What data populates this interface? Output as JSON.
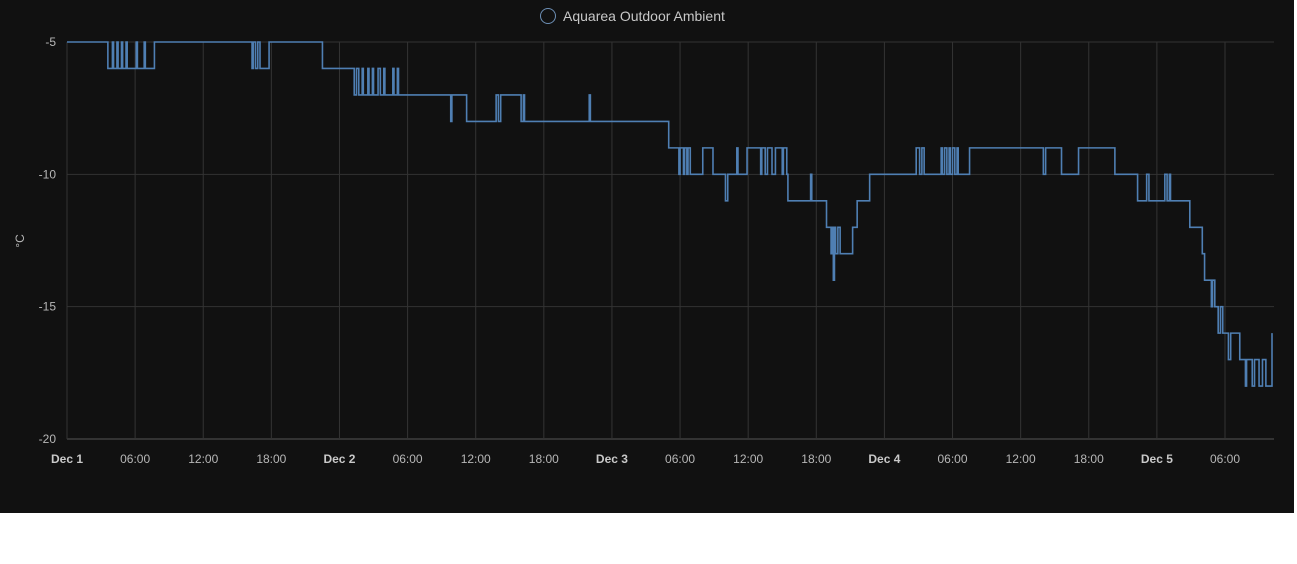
{
  "legend": {
    "label": "Aquarea Outdoor Ambient",
    "color": "#6d8fb5"
  },
  "colors": {
    "background": "#111111",
    "grid": "#333333",
    "line": "#4f7fb3",
    "text": "#b7b7b7"
  },
  "chart_data": {
    "type": "line",
    "ylabel": "°C",
    "ylim": [
      -20,
      -5
    ],
    "yticks": [
      -5,
      -10,
      -15,
      -20
    ],
    "xlim_hours": [
      0,
      104.5
    ],
    "xticks": [
      {
        "h": 0,
        "label": "Dec 1",
        "major": true
      },
      {
        "h": 6,
        "label": "06:00",
        "major": false
      },
      {
        "h": 12,
        "label": "12:00",
        "major": false
      },
      {
        "h": 18,
        "label": "18:00",
        "major": false
      },
      {
        "h": 24,
        "label": "Dec 2",
        "major": true
      },
      {
        "h": 30,
        "label": "06:00",
        "major": false
      },
      {
        "h": 36,
        "label": "12:00",
        "major": false
      },
      {
        "h": 42,
        "label": "18:00",
        "major": false
      },
      {
        "h": 48,
        "label": "Dec 3",
        "major": true
      },
      {
        "h": 54,
        "label": "06:00",
        "major": false
      },
      {
        "h": 60,
        "label": "12:00",
        "major": false
      },
      {
        "h": 66,
        "label": "18:00",
        "major": false
      },
      {
        "h": 72,
        "label": "Dec 4",
        "major": true
      },
      {
        "h": 78,
        "label": "06:00",
        "major": false
      },
      {
        "h": 84,
        "label": "12:00",
        "major": false
      },
      {
        "h": 90,
        "label": "18:00",
        "major": false
      },
      {
        "h": 96,
        "label": "Dec 5",
        "major": true
      },
      {
        "h": 102,
        "label": "06:00",
        "major": false
      }
    ],
    "grid": true,
    "legend_position": "top-center",
    "series": [
      {
        "name": "Aquarea Outdoor Ambient",
        "points": [
          [
            0,
            -5
          ],
          [
            3.6,
            -6
          ],
          [
            4.0,
            -5
          ],
          [
            4.1,
            -6
          ],
          [
            4.4,
            -5
          ],
          [
            4.5,
            -6
          ],
          [
            4.8,
            -5
          ],
          [
            4.9,
            -6
          ],
          [
            5.2,
            -5
          ],
          [
            5.3,
            -6
          ],
          [
            6.1,
            -5
          ],
          [
            6.2,
            -6
          ],
          [
            6.8,
            -5
          ],
          [
            6.9,
            -6
          ],
          [
            7.7,
            -5
          ],
          [
            16.3,
            -6
          ],
          [
            16.4,
            -5
          ],
          [
            16.6,
            -6
          ],
          [
            16.8,
            -5
          ],
          [
            17.0,
            -6
          ],
          [
            17.8,
            -5
          ],
          [
            22.5,
            -6
          ],
          [
            25.3,
            -7
          ],
          [
            25.5,
            -6
          ],
          [
            25.7,
            -7
          ],
          [
            26.0,
            -6
          ],
          [
            26.1,
            -7
          ],
          [
            26.5,
            -6
          ],
          [
            26.6,
            -7
          ],
          [
            26.9,
            -6
          ],
          [
            27.0,
            -7
          ],
          [
            27.4,
            -6
          ],
          [
            27.6,
            -7
          ],
          [
            27.9,
            -6
          ],
          [
            28.0,
            -7
          ],
          [
            28.7,
            -6
          ],
          [
            28.8,
            -7
          ],
          [
            29.1,
            -6
          ],
          [
            29.2,
            -7
          ],
          [
            33.8,
            -8
          ],
          [
            33.9,
            -7
          ],
          [
            35.2,
            -8
          ],
          [
            37.8,
            -7
          ],
          [
            38.0,
            -8
          ],
          [
            38.2,
            -7
          ],
          [
            40.0,
            -8
          ],
          [
            40.2,
            -7
          ],
          [
            40.3,
            -8
          ],
          [
            46.0,
            -7
          ],
          [
            46.1,
            -8
          ],
          [
            53.0,
            -9
          ],
          [
            53.9,
            -10
          ],
          [
            54.0,
            -9
          ],
          [
            54.3,
            -10
          ],
          [
            54.4,
            -9
          ],
          [
            54.6,
            -10
          ],
          [
            54.7,
            -9
          ],
          [
            54.9,
            -10
          ],
          [
            56.0,
            -9
          ],
          [
            56.9,
            -10
          ],
          [
            58.0,
            -11
          ],
          [
            58.2,
            -10
          ],
          [
            59.0,
            -9
          ],
          [
            59.1,
            -10
          ],
          [
            59.9,
            -9
          ],
          [
            61.1,
            -10
          ],
          [
            61.2,
            -9
          ],
          [
            61.5,
            -10
          ],
          [
            61.7,
            -9
          ],
          [
            62.1,
            -10
          ],
          [
            62.4,
            -9
          ],
          [
            63.0,
            -10
          ],
          [
            63.1,
            -9
          ],
          [
            63.4,
            -10
          ],
          [
            63.5,
            -11
          ],
          [
            65.5,
            -10
          ],
          [
            65.6,
            -11
          ],
          [
            66.9,
            -12
          ],
          [
            67.3,
            -13
          ],
          [
            67.4,
            -12
          ],
          [
            67.5,
            -14
          ],
          [
            67.6,
            -12
          ],
          [
            67.7,
            -13
          ],
          [
            67.9,
            -12
          ],
          [
            68.1,
            -13
          ],
          [
            69.2,
            -12
          ],
          [
            69.6,
            -11
          ],
          [
            70.7,
            -10
          ],
          [
            74.8,
            -9
          ],
          [
            75.1,
            -10
          ],
          [
            75.3,
            -9
          ],
          [
            75.5,
            -10
          ],
          [
            77.0,
            -9
          ],
          [
            77.1,
            -10
          ],
          [
            77.3,
            -9
          ],
          [
            77.5,
            -10
          ],
          [
            77.7,
            -9
          ],
          [
            77.8,
            -10
          ],
          [
            78.0,
            -9
          ],
          [
            78.2,
            -10
          ],
          [
            78.4,
            -9
          ],
          [
            78.5,
            -10
          ],
          [
            79.5,
            -9
          ],
          [
            86.0,
            -10
          ],
          [
            86.2,
            -9
          ],
          [
            87.6,
            -10
          ],
          [
            89.1,
            -9
          ],
          [
            92.3,
            -10
          ],
          [
            94.3,
            -11
          ],
          [
            95.1,
            -10
          ],
          [
            95.3,
            -11
          ],
          [
            96.7,
            -10
          ],
          [
            96.9,
            -11
          ],
          [
            97.1,
            -10
          ],
          [
            97.2,
            -11
          ],
          [
            98.9,
            -12
          ],
          [
            100.0,
            -13
          ],
          [
            100.2,
            -14
          ],
          [
            100.8,
            -15
          ],
          [
            100.9,
            -14
          ],
          [
            101.1,
            -15
          ],
          [
            101.4,
            -16
          ],
          [
            101.6,
            -15
          ],
          [
            101.8,
            -16
          ],
          [
            102.3,
            -17
          ],
          [
            102.5,
            -16
          ],
          [
            103.3,
            -17
          ],
          [
            103.8,
            -18
          ],
          [
            103.9,
            -17
          ],
          [
            104.4,
            -18
          ],
          [
            104.6,
            -17
          ],
          [
            105.0,
            -18
          ],
          [
            105.3,
            -17
          ],
          [
            105.6,
            -18
          ],
          [
            106.3,
            -17
          ],
          [
            106.6,
            -18
          ],
          [
            106.9,
            -17
          ],
          [
            107.3,
            -16
          ],
          [
            107.4,
            -16
          ]
        ]
      }
    ]
  }
}
